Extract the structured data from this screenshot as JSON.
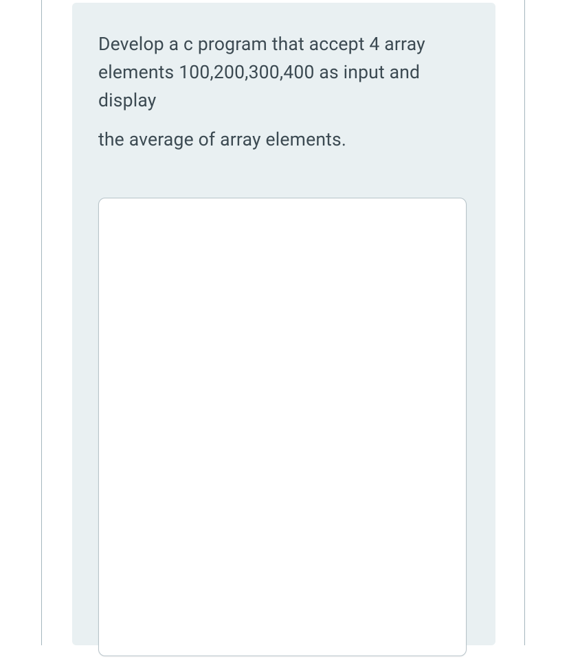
{
  "question": {
    "paragraphs": [
      "Develop a c program that accept 4 array elements 100,200,300,400 as input and display",
      "the average of array elements."
    ]
  },
  "answer": {
    "value": "",
    "placeholder": ""
  }
}
